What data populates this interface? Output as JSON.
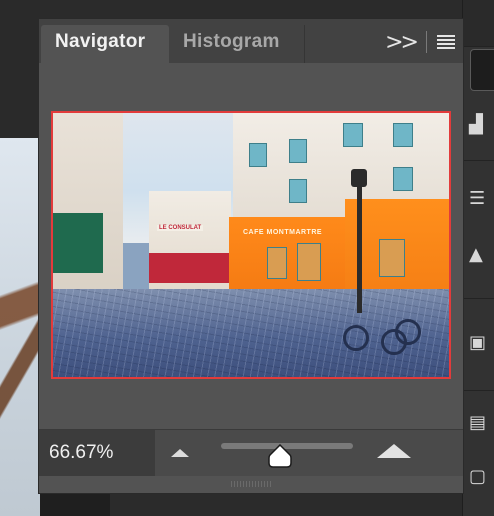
{
  "panel": {
    "tabs": [
      {
        "label": "Navigator",
        "active": true
      },
      {
        "label": "Histogram",
        "active": false
      }
    ],
    "collapse_icon": "double-chevron-right-icon",
    "menu_icon": "panel-menu-icon"
  },
  "preview": {
    "frame_color": "#e23b3b",
    "sign_text": "CAFE MONTMARTRE",
    "sign_text_2": "LE CONSULAT"
  },
  "zoom": {
    "value": "66.67%",
    "zoom_out_icon": "mountain-small-icon",
    "zoom_in_icon": "mountain-large-icon",
    "slider_level": 0.45
  },
  "right_toolbar": {
    "icons": [
      "navigator-icon",
      "histogram-icon",
      "properties-icon",
      "brush-icon",
      "layers-icon",
      "info-icon",
      "document-icon"
    ]
  },
  "colors": {
    "panel_bg": "#535353",
    "tabbar_bg": "#424242",
    "accent_frame": "#e23b3b"
  }
}
